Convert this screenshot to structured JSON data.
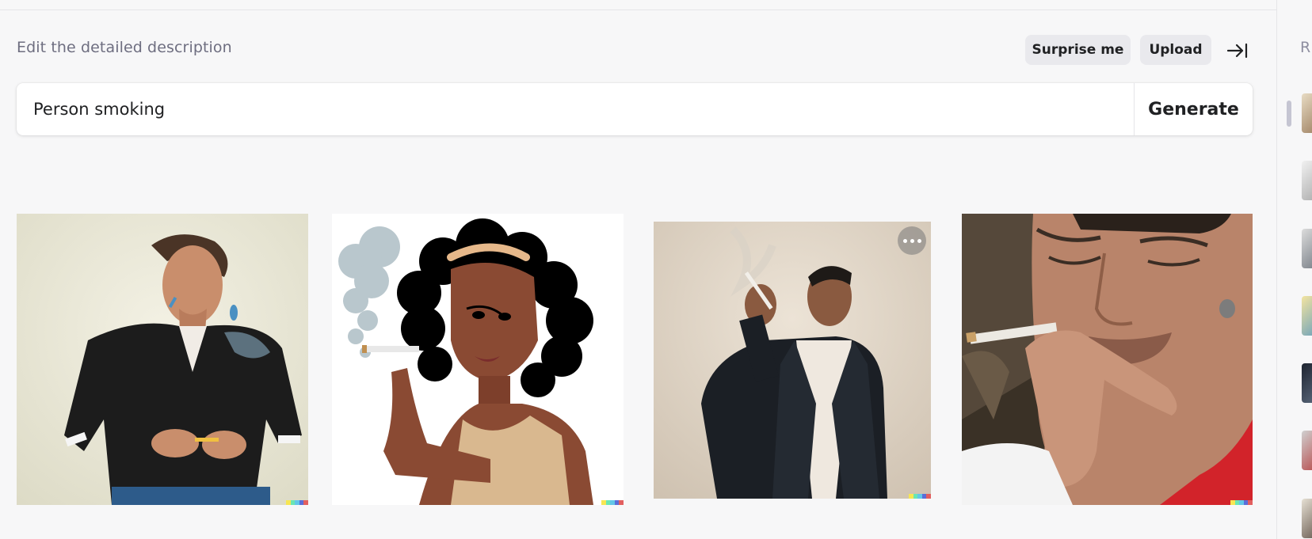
{
  "header": {
    "description_label": "Edit the detailed description",
    "surprise_label": "Surprise me",
    "upload_label": "Upload"
  },
  "prompt": {
    "value": "Person smoking",
    "generate_label": "Generate"
  },
  "images": [
    {
      "subject": "woman in black shirt lighting a cigarette"
    },
    {
      "subject": "illustrated woman with curly black hair smoking"
    },
    {
      "subject": "man in suit smoking a cigarette",
      "has_more_menu": true
    },
    {
      "subject": "close-up of man holding cigarette to lips"
    }
  ],
  "sidebar": {
    "title_partial": "R",
    "thumbnail_count": 7
  },
  "colors": {
    "background": "#f7f7f8",
    "pill": "#e9e9ed",
    "signature": [
      "#f7e652",
      "#6be6b3",
      "#62c7e8",
      "#5a6ed8",
      "#e25f5f"
    ]
  }
}
